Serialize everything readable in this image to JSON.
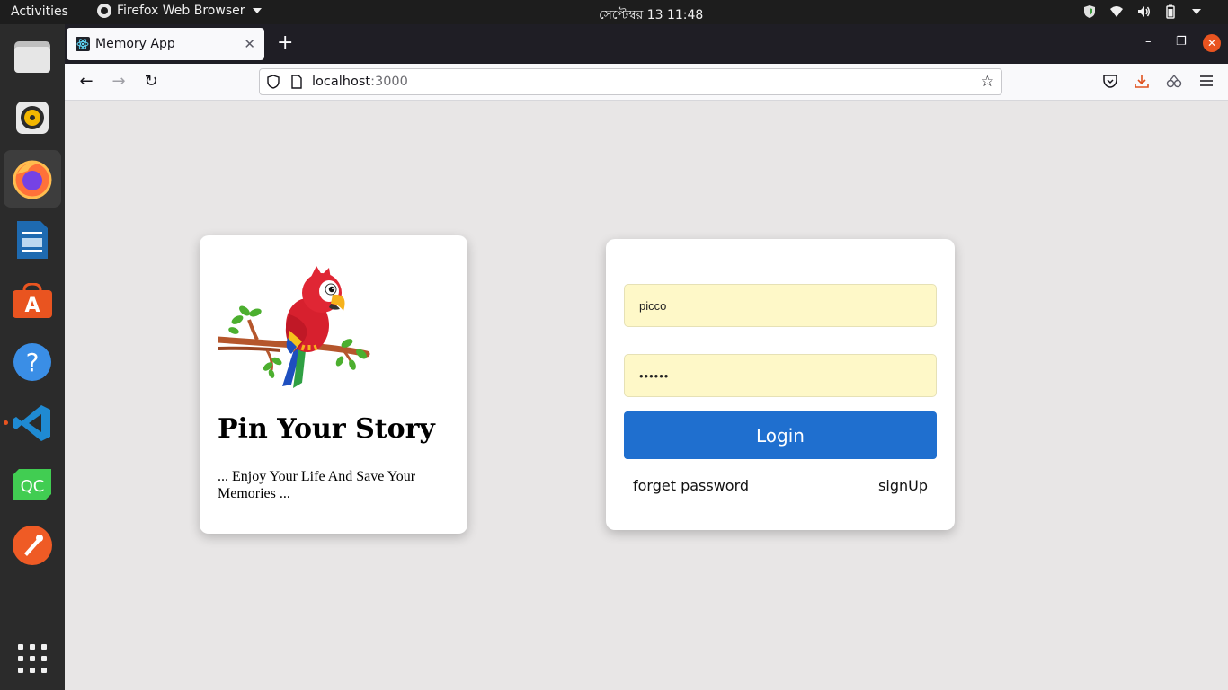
{
  "topbar": {
    "activities": "Activities",
    "app_menu_label": "Firefox Web Browser",
    "clock": "সেপ্টেম্বর 13  11:48"
  },
  "dock": {
    "items": [
      {
        "name": "files"
      },
      {
        "name": "rhythmbox"
      },
      {
        "name": "firefox"
      },
      {
        "name": "libreoffice-writer"
      },
      {
        "name": "ubuntu-software"
      },
      {
        "name": "help"
      },
      {
        "name": "vscode"
      },
      {
        "name": "qt-creator"
      },
      {
        "name": "postman"
      },
      {
        "name": "show-applications"
      }
    ],
    "qc_label": "QC",
    "help_label": "?"
  },
  "browser": {
    "tab_title": "Memory App",
    "url_host": "localhost",
    "url_port": ":3000"
  },
  "left_card": {
    "title": "Pin Your Story",
    "subtitle": "... Enjoy Your Life And Save Your Memories ..."
  },
  "login": {
    "username_value": "picco",
    "password_value": "••••••",
    "login_label": "Login",
    "forget_label": "forget password",
    "signup_label": "signUp"
  },
  "colors": {
    "login_button": "#1f6fcf",
    "input_bg": "#fef8c8",
    "accent": "#e95420"
  }
}
